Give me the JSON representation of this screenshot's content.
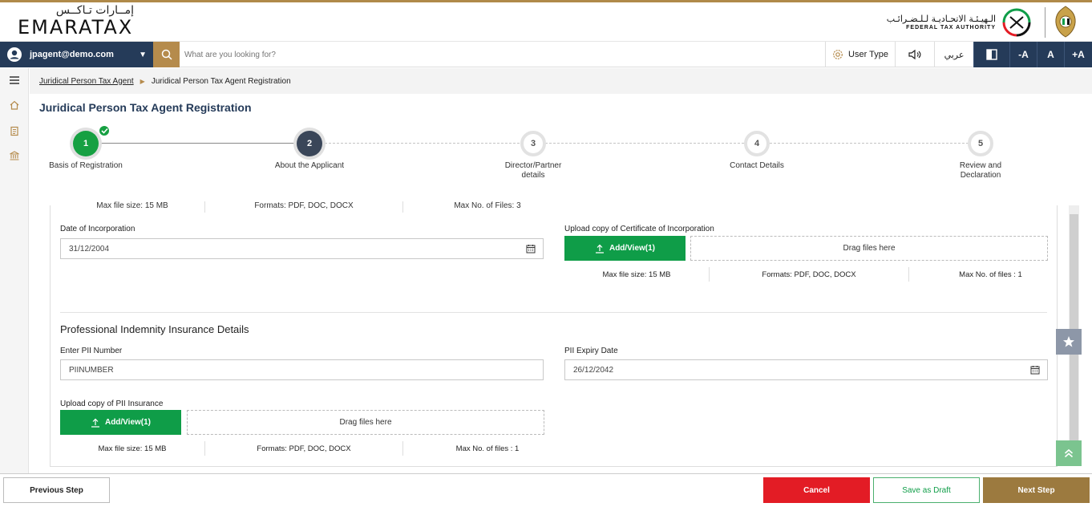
{
  "header": {
    "logo_ar": "إمــارات تـاكــس",
    "logo_en": "EMARATAX",
    "fta_ar": "الـهيـئـة الاتحـاديـة لـلـضـرائـب",
    "fta_en": "FEDERAL TAX AUTHORITY"
  },
  "toolbar": {
    "user_email": "jpagent@demo.com",
    "search_placeholder": "What are you looking for?",
    "user_type_label": "User Type",
    "language_label": "عربي",
    "font_minus": "-A",
    "font_normal": "A",
    "font_plus": "+A"
  },
  "breadcrumb": {
    "parent": "Juridical Person Tax Agent",
    "current": "Juridical Person Tax Agent Registration"
  },
  "page_title": "Juridical Person Tax Agent Registration",
  "steps": [
    {
      "number": "1",
      "label": "Basis of Registration",
      "state": "done"
    },
    {
      "number": "2",
      "label": "About the Applicant",
      "state": "active"
    },
    {
      "number": "3",
      "label_line1": "Director/Partner",
      "label_line2": "details",
      "state": "todo"
    },
    {
      "number": "4",
      "label": "Contact Details",
      "state": "todo"
    },
    {
      "number": "5",
      "label_line1": "Review and",
      "label_line2": "Declaration",
      "state": "todo"
    }
  ],
  "cut_row": {
    "size": "Max file size: 15 MB",
    "formats": "Formats: PDF, DOC, DOCX",
    "count": "Max No. of Files: 3"
  },
  "incorporation": {
    "date_label": "Date of Incorporation",
    "date_value": "31/12/2004",
    "upload_label": "Upload copy of Certificate of Incorporation",
    "add_label": "Add/View(1)",
    "drop_label": "Drag files here",
    "size": "Max file size: 15 MB",
    "formats": "Formats: PDF, DOC, DOCX",
    "count": "Max No. of files : 1"
  },
  "pii": {
    "section_title": "Professional Indemnity Insurance Details",
    "number_label": "Enter PII Number",
    "number_value": "PIINUMBER",
    "expiry_label": "PII Expiry Date",
    "expiry_value": "26/12/2042",
    "upload_label": "Upload copy of PII Insurance",
    "add_label": "Add/View(1)",
    "drop_label": "Drag files here",
    "size": "Max file size: 15 MB",
    "formats": "Formats: PDF, DOC, DOCX",
    "count": "Max No. of files : 1"
  },
  "footer": {
    "prev": "Previous Step",
    "cancel": "Cancel",
    "draft": "Save as Draft",
    "next": "Next Step"
  },
  "colors": {
    "navy": "#253b59",
    "gold": "#b58b4c",
    "green": "#0f9d48",
    "red": "#e31c25"
  }
}
